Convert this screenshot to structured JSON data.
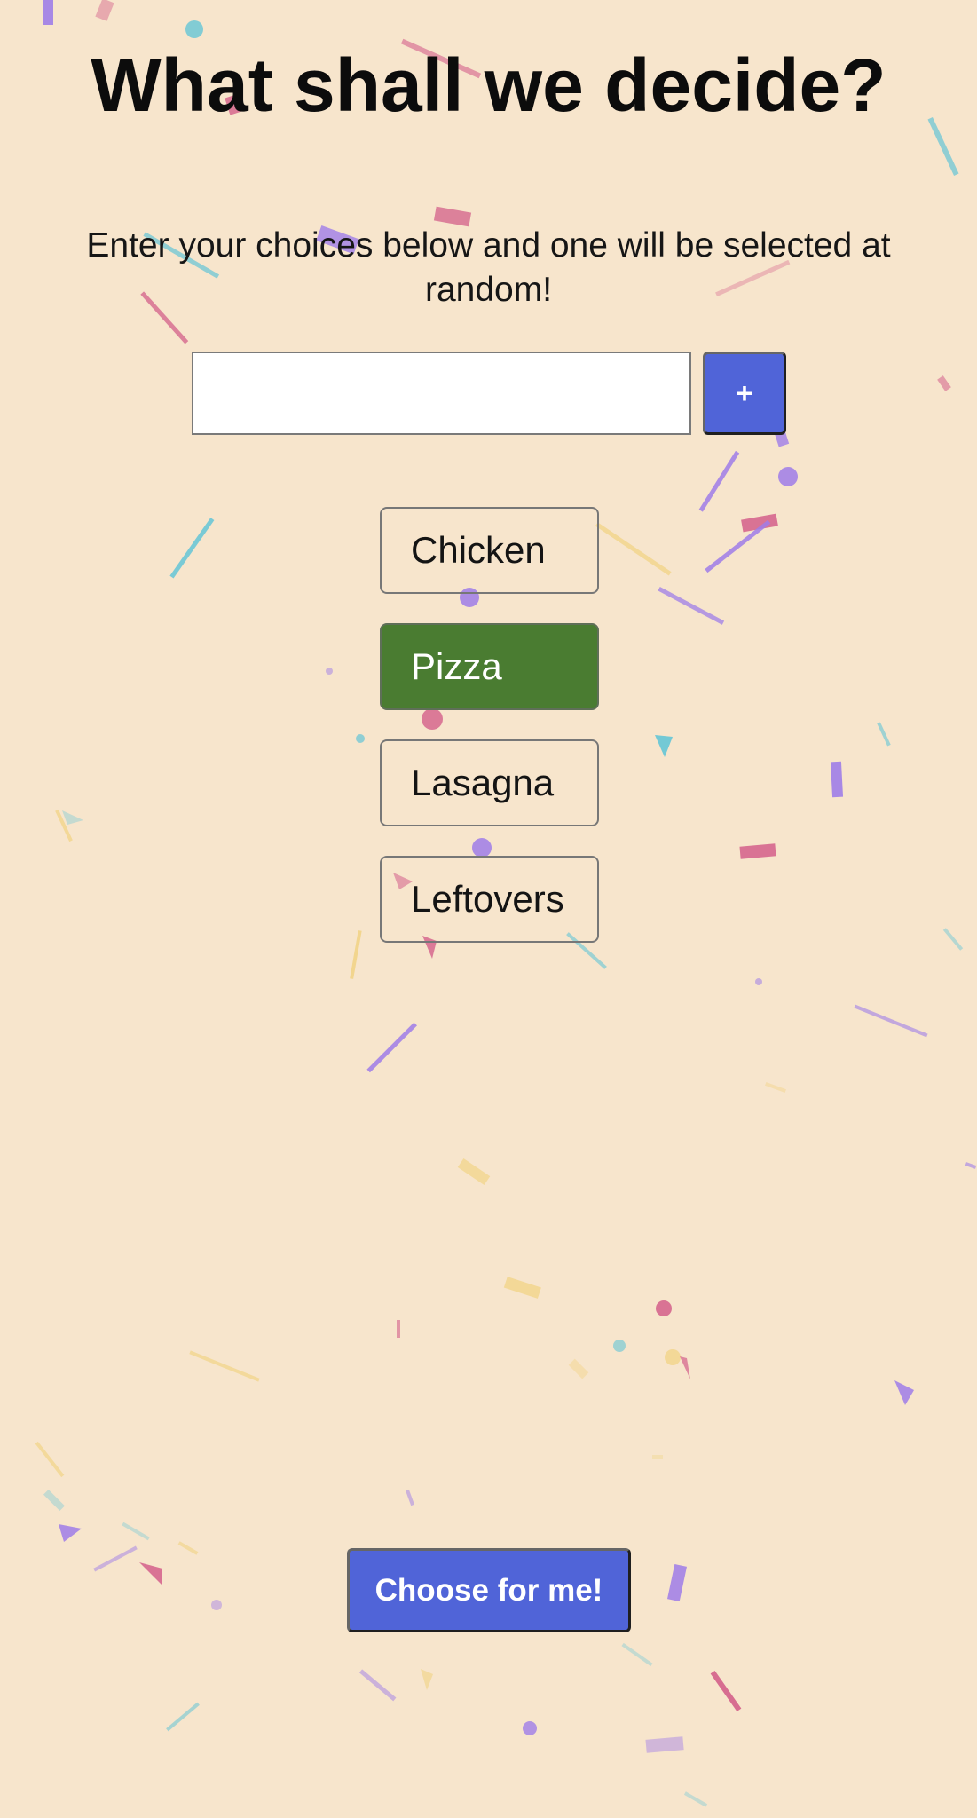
{
  "header": {
    "title": "What shall we decide?"
  },
  "instructions": {
    "text": "Enter your choices below and one will be selected at random!"
  },
  "choice_entry": {
    "value": "",
    "placeholder": "",
    "add_label": "+"
  },
  "choices": [
    {
      "label": "Chicken",
      "selected": false
    },
    {
      "label": "Pizza",
      "selected": true
    },
    {
      "label": "Lasagna",
      "selected": false
    },
    {
      "label": "Leftovers",
      "selected": false
    }
  ],
  "actions": {
    "choose_label": "Choose for me!"
  },
  "colors": {
    "background": "#f7e5cc",
    "button": "#5064d8",
    "selected_choice": "#4a7c31",
    "confetti": [
      "#9f7de8",
      "#d35f8a",
      "#64c5d6",
      "#f0cf73"
    ]
  }
}
